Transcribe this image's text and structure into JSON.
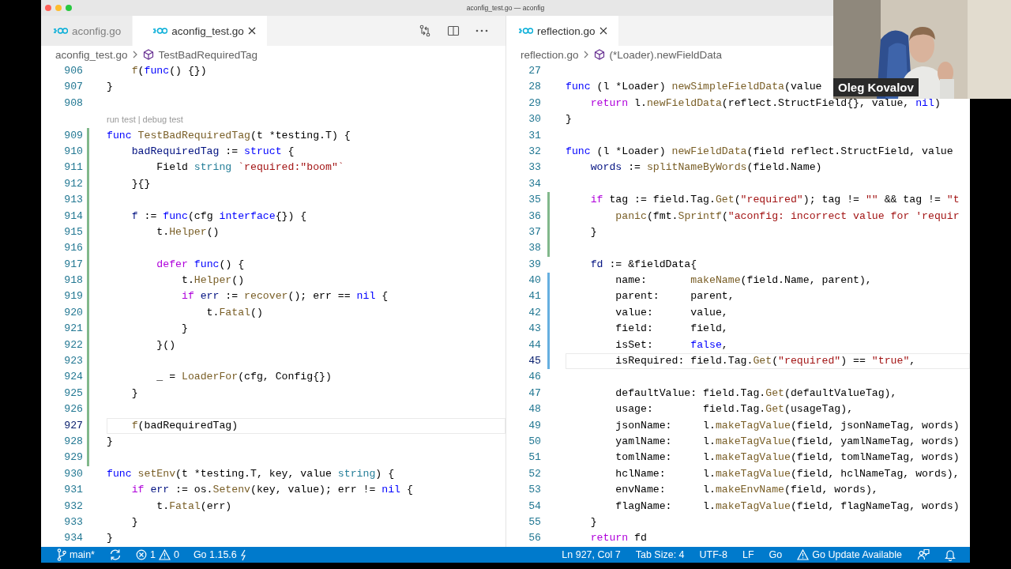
{
  "window": {
    "title": "aconfig_test.go — aconfig"
  },
  "editor_groups": [
    {
      "tabs": [
        {
          "label": "aconfig.go",
          "selected": false
        },
        {
          "label": "aconfig_test.go",
          "selected": true
        }
      ],
      "actions": [
        {
          "kind": "compare"
        },
        {
          "kind": "split"
        },
        {
          "kind": "more"
        }
      ],
      "breadcrumbs": {
        "file": "aconfig_test.go",
        "symbol": "TestBadRequiredTag"
      },
      "lines": [
        {
          "kind": "code",
          "number": "906",
          "current": false,
          "tokens": [
            {
              "kind": "function",
              "text": "    f"
            },
            {
              "kind": "plain",
              "text": "("
            },
            {
              "kind": "keyword",
              "text": "func"
            },
            {
              "kind": "plain",
              "text": "() {})"
            }
          ]
        },
        {
          "kind": "code",
          "number": "907",
          "current": false,
          "tokens": [
            {
              "kind": "plain",
              "text": "}"
            }
          ]
        },
        {
          "kind": "code",
          "number": "908",
          "current": false
        },
        {
          "kind": "codelens",
          "links": [
            "run test",
            "debug test"
          ],
          "separator": "|"
        },
        {
          "kind": "code",
          "number": "909",
          "current": false,
          "color": "#81b88b",
          "tokens": [
            {
              "kind": "keyword",
              "text": "func"
            },
            {
              "kind": "function",
              "text": " TestBadRequiredTag"
            },
            {
              "kind": "plain",
              "text": "(t *testing.T) {"
            }
          ]
        },
        {
          "kind": "code",
          "number": "910",
          "current": false,
          "color": "#81b88b",
          "tokens": [
            {
              "kind": "variable",
              "text": "    badRequiredTag"
            },
            {
              "kind": "plain",
              "text": " := "
            },
            {
              "kind": "keyword",
              "text": "struct"
            },
            {
              "kind": "plain",
              "text": " {"
            }
          ]
        },
        {
          "kind": "code",
          "number": "911",
          "current": false,
          "color": "#81b88b",
          "tokens": [
            {
              "kind": "plain",
              "text": "        Field "
            },
            {
              "kind": "type",
              "text": "string"
            },
            {
              "kind": "string",
              "text": " `required:\"boom\"`"
            }
          ]
        },
        {
          "kind": "code",
          "number": "912",
          "current": false,
          "color": "#81b88b",
          "tokens": [
            {
              "kind": "plain",
              "text": "    }{}"
            }
          ]
        },
        {
          "kind": "code",
          "number": "913",
          "current": false,
          "color": "#81b88b"
        },
        {
          "kind": "code",
          "number": "914",
          "current": false,
          "color": "#81b88b",
          "tokens": [
            {
              "kind": "variable",
              "text": "    f"
            },
            {
              "kind": "plain",
              "text": " := "
            },
            {
              "kind": "keyword",
              "text": "func"
            },
            {
              "kind": "plain",
              "text": "(cfg "
            },
            {
              "kind": "keyword",
              "text": "interface"
            },
            {
              "kind": "plain",
              "text": "{}) {"
            }
          ]
        },
        {
          "kind": "code",
          "number": "915",
          "current": false,
          "color": "#81b88b",
          "tokens": [
            {
              "kind": "plain",
              "text": "        t."
            },
            {
              "kind": "function",
              "text": "Helper"
            },
            {
              "kind": "plain",
              "text": "()"
            }
          ]
        },
        {
          "kind": "code",
          "number": "916",
          "current": false,
          "color": "#81b88b"
        },
        {
          "kind": "code",
          "number": "917",
          "current": false,
          "color": "#81b88b",
          "tokens": [
            {
              "kind": "control",
              "text": "        defer"
            },
            {
              "kind": "keyword",
              "text": " func"
            },
            {
              "kind": "plain",
              "text": "() {"
            }
          ]
        },
        {
          "kind": "code",
          "number": "918",
          "current": false,
          "color": "#81b88b",
          "tokens": [
            {
              "kind": "plain",
              "text": "            t."
            },
            {
              "kind": "function",
              "text": "Helper"
            },
            {
              "kind": "plain",
              "text": "()"
            }
          ]
        },
        {
          "kind": "code",
          "number": "919",
          "current": false,
          "color": "#81b88b",
          "tokens": [
            {
              "kind": "control",
              "text": "            if"
            },
            {
              "kind": "variable",
              "text": " err"
            },
            {
              "kind": "plain",
              "text": " := "
            },
            {
              "kind": "function",
              "text": "recover"
            },
            {
              "kind": "plain",
              "text": "(); err == "
            },
            {
              "kind": "keyword",
              "text": "nil"
            },
            {
              "kind": "plain",
              "text": " {"
            }
          ]
        },
        {
          "kind": "code",
          "number": "920",
          "current": false,
          "color": "#81b88b",
          "tokens": [
            {
              "kind": "plain",
              "text": "                t."
            },
            {
              "kind": "function",
              "text": "Fatal"
            },
            {
              "kind": "plain",
              "text": "()"
            }
          ]
        },
        {
          "kind": "code",
          "number": "921",
          "current": false,
          "color": "#81b88b",
          "tokens": [
            {
              "kind": "plain",
              "text": "            }"
            }
          ]
        },
        {
          "kind": "code",
          "number": "922",
          "current": false,
          "color": "#81b88b",
          "tokens": [
            {
              "kind": "plain",
              "text": "        }()"
            }
          ]
        },
        {
          "kind": "code",
          "number": "923",
          "current": false,
          "color": "#81b88b"
        },
        {
          "kind": "code",
          "number": "924",
          "current": false,
          "color": "#81b88b",
          "tokens": [
            {
              "kind": "plain",
              "text": "        _ = "
            },
            {
              "kind": "function",
              "text": "LoaderFor"
            },
            {
              "kind": "plain",
              "text": "(cfg, Config{})"
            }
          ]
        },
        {
          "kind": "code",
          "number": "925",
          "current": false,
          "color": "#81b88b",
          "tokens": [
            {
              "kind": "plain",
              "text": "    }"
            }
          ]
        },
        {
          "kind": "code",
          "number": "926",
          "current": false,
          "color": "#81b88b"
        },
        {
          "kind": "code",
          "number": "927",
          "current": true,
          "color": "#81b88b",
          "tokens": [
            {
              "kind": "function",
              "text": "    f"
            },
            {
              "kind": "plain",
              "text": "(badRequiredTag)"
            }
          ]
        },
        {
          "kind": "code",
          "number": "928",
          "current": false,
          "color": "#81b88b",
          "tokens": [
            {
              "kind": "plain",
              "text": "}"
            }
          ]
        },
        {
          "kind": "code",
          "number": "929",
          "current": false,
          "color": "#81b88b"
        },
        {
          "kind": "code",
          "number": "930",
          "current": false,
          "tokens": [
            {
              "kind": "keyword",
              "text": "func"
            },
            {
              "kind": "function",
              "text": " setEnv"
            },
            {
              "kind": "plain",
              "text": "(t *testing.T, key, value "
            },
            {
              "kind": "type",
              "text": "string"
            },
            {
              "kind": "plain",
              "text": ") {"
            }
          ]
        },
        {
          "kind": "code",
          "number": "931",
          "current": false,
          "tokens": [
            {
              "kind": "control",
              "text": "    if"
            },
            {
              "kind": "variable",
              "text": " err"
            },
            {
              "kind": "plain",
              "text": " := os."
            },
            {
              "kind": "function",
              "text": "Setenv"
            },
            {
              "kind": "plain",
              "text": "(key, value); err != "
            },
            {
              "kind": "keyword",
              "text": "nil"
            },
            {
              "kind": "plain",
              "text": " {"
            }
          ]
        },
        {
          "kind": "code",
          "number": "932",
          "current": false,
          "tokens": [
            {
              "kind": "plain",
              "text": "        t."
            },
            {
              "kind": "function",
              "text": "Fatal"
            },
            {
              "kind": "plain",
              "text": "(err)"
            }
          ]
        },
        {
          "kind": "code",
          "number": "933",
          "current": false,
          "tokens": [
            {
              "kind": "plain",
              "text": "    }"
            }
          ]
        },
        {
          "kind": "code",
          "number": "934",
          "current": false,
          "tokens": [
            {
              "kind": "plain",
              "text": "}"
            }
          ]
        }
      ]
    },
    {
      "tabs": [
        {
          "label": "reflection.go",
          "selected": true
        }
      ],
      "breadcrumbs": {
        "file": "reflection.go",
        "symbol": "(*Loader).newFieldData"
      },
      "lines": [
        {
          "kind": "code",
          "number": "27",
          "current": false
        },
        {
          "kind": "code",
          "number": "28",
          "current": false,
          "tokens": [
            {
              "kind": "keyword",
              "text": "func"
            },
            {
              "kind": "plain",
              "text": " (l *Loader) "
            },
            {
              "kind": "function",
              "text": "newSimpleFieldData"
            },
            {
              "kind": "plain",
              "text": "(value"
            }
          ]
        },
        {
          "kind": "code",
          "number": "29",
          "current": false,
          "tokens": [
            {
              "kind": "control",
              "text": "    return"
            },
            {
              "kind": "plain",
              "text": " l."
            },
            {
              "kind": "function",
              "text": "newFieldData"
            },
            {
              "kind": "plain",
              "text": "(reflect.StructField{}, value, "
            },
            {
              "kind": "keyword",
              "text": "nil"
            },
            {
              "kind": "plain",
              "text": ")"
            }
          ]
        },
        {
          "kind": "code",
          "number": "30",
          "current": false,
          "tokens": [
            {
              "kind": "plain",
              "text": "}"
            }
          ]
        },
        {
          "kind": "code",
          "number": "31",
          "current": false
        },
        {
          "kind": "code",
          "number": "32",
          "current": false,
          "tokens": [
            {
              "kind": "keyword",
              "text": "func"
            },
            {
              "kind": "plain",
              "text": " (l *Loader) "
            },
            {
              "kind": "function",
              "text": "newFieldData"
            },
            {
              "kind": "plain",
              "text": "(field reflect.StructField, value"
            }
          ]
        },
        {
          "kind": "code",
          "number": "33",
          "current": false,
          "tokens": [
            {
              "kind": "variable",
              "text": "    words"
            },
            {
              "kind": "plain",
              "text": " := "
            },
            {
              "kind": "function",
              "text": "splitNameByWords"
            },
            {
              "kind": "plain",
              "text": "(field.Name)"
            }
          ]
        },
        {
          "kind": "code",
          "number": "34",
          "current": false
        },
        {
          "kind": "code",
          "number": "35",
          "current": false,
          "color": "#81b88b",
          "tokens": [
            {
              "kind": "control",
              "text": "    if"
            },
            {
              "kind": "plain",
              "text": " tag := field.Tag."
            },
            {
              "kind": "function",
              "text": "Get"
            },
            {
              "kind": "plain",
              "text": "("
            },
            {
              "kind": "string",
              "text": "\"required\""
            },
            {
              "kind": "plain",
              "text": "); tag != "
            },
            {
              "kind": "string",
              "text": "\"\""
            },
            {
              "kind": "plain",
              "text": " && tag != "
            },
            {
              "kind": "string",
              "text": "\"t"
            }
          ]
        },
        {
          "kind": "code",
          "number": "36",
          "current": false,
          "color": "#81b88b",
          "tokens": [
            {
              "kind": "function",
              "text": "        panic"
            },
            {
              "kind": "plain",
              "text": "(fmt."
            },
            {
              "kind": "function",
              "text": "Sprintf"
            },
            {
              "kind": "plain",
              "text": "("
            },
            {
              "kind": "string",
              "text": "\"aconfig: incorrect value for 'requir"
            }
          ]
        },
        {
          "kind": "code",
          "number": "37",
          "current": false,
          "color": "#81b88b",
          "tokens": [
            {
              "kind": "plain",
              "text": "    }"
            }
          ]
        },
        {
          "kind": "code",
          "number": "38",
          "current": false,
          "color": "#81b88b"
        },
        {
          "kind": "code",
          "number": "39",
          "current": false,
          "tokens": [
            {
              "kind": "variable",
              "text": "    fd"
            },
            {
              "kind": "plain",
              "text": " := &fieldData{"
            }
          ]
        },
        {
          "kind": "code",
          "number": "40",
          "current": false,
          "color": "#66afe0",
          "tokens": [
            {
              "kind": "plain",
              "text": "        name:       "
            },
            {
              "kind": "function",
              "text": "makeName"
            },
            {
              "kind": "plain",
              "text": "(field.Name, parent),"
            }
          ]
        },
        {
          "kind": "code",
          "number": "41",
          "current": false,
          "color": "#66afe0",
          "tokens": [
            {
              "kind": "plain",
              "text": "        parent:     parent,"
            }
          ]
        },
        {
          "kind": "code",
          "number": "42",
          "current": false,
          "color": "#66afe0",
          "tokens": [
            {
              "kind": "plain",
              "text": "        value:      value,"
            }
          ]
        },
        {
          "kind": "code",
          "number": "43",
          "current": false,
          "color": "#66afe0",
          "tokens": [
            {
              "kind": "plain",
              "text": "        field:      field,"
            }
          ]
        },
        {
          "kind": "code",
          "number": "44",
          "current": false,
          "color": "#66afe0",
          "tokens": [
            {
              "kind": "plain",
              "text": "        isSet:      "
            },
            {
              "kind": "keyword",
              "text": "false"
            },
            {
              "kind": "plain",
              "text": ","
            }
          ]
        },
        {
          "kind": "code",
          "number": "45",
          "current": true,
          "color": "#66afe0",
          "tokens": [
            {
              "kind": "plain",
              "text": "        isRequired: field.Tag."
            },
            {
              "kind": "function",
              "text": "Get"
            },
            {
              "kind": "plain",
              "text": "("
            },
            {
              "kind": "string",
              "text": "\"required\""
            },
            {
              "kind": "plain",
              "text": ") == "
            },
            {
              "kind": "string",
              "text": "\"true\""
            },
            {
              "kind": "plain",
              "text": ","
            }
          ]
        },
        {
          "kind": "code",
          "number": "46",
          "current": false
        },
        {
          "kind": "code",
          "number": "47",
          "current": false,
          "tokens": [
            {
              "kind": "plain",
              "text": "        defaultValue: field.Tag."
            },
            {
              "kind": "function",
              "text": "Get"
            },
            {
              "kind": "plain",
              "text": "(defaultValueTag),"
            }
          ]
        },
        {
          "kind": "code",
          "number": "48",
          "current": false,
          "tokens": [
            {
              "kind": "plain",
              "text": "        usage:        field.Tag."
            },
            {
              "kind": "function",
              "text": "Get"
            },
            {
              "kind": "plain",
              "text": "(usageTag),"
            }
          ]
        },
        {
          "kind": "code",
          "number": "49",
          "current": false,
          "tokens": [
            {
              "kind": "plain",
              "text": "        jsonName:     l."
            },
            {
              "kind": "function",
              "text": "makeTagValue"
            },
            {
              "kind": "plain",
              "text": "(field, jsonNameTag, words)"
            }
          ]
        },
        {
          "kind": "code",
          "number": "50",
          "current": false,
          "tokens": [
            {
              "kind": "plain",
              "text": "        yamlName:     l."
            },
            {
              "kind": "function",
              "text": "makeTagValue"
            },
            {
              "kind": "plain",
              "text": "(field, yamlNameTag, words)"
            }
          ]
        },
        {
          "kind": "code",
          "number": "51",
          "current": false,
          "tokens": [
            {
              "kind": "plain",
              "text": "        tomlName:     l."
            },
            {
              "kind": "function",
              "text": "makeTagValue"
            },
            {
              "kind": "plain",
              "text": "(field, tomlNameTag, words)"
            }
          ]
        },
        {
          "kind": "code",
          "number": "52",
          "current": false,
          "tokens": [
            {
              "kind": "plain",
              "text": "        hclName:      l."
            },
            {
              "kind": "function",
              "text": "makeTagValue"
            },
            {
              "kind": "plain",
              "text": "(field, hclNameTag, words),"
            }
          ]
        },
        {
          "kind": "code",
          "number": "53",
          "current": false,
          "tokens": [
            {
              "kind": "plain",
              "text": "        envName:      l."
            },
            {
              "kind": "function",
              "text": "makeEnvName"
            },
            {
              "kind": "plain",
              "text": "(field, words),"
            }
          ]
        },
        {
          "kind": "code",
          "number": "54",
          "current": false,
          "tokens": [
            {
              "kind": "plain",
              "text": "        flagName:     l."
            },
            {
              "kind": "function",
              "text": "makeTagValue"
            },
            {
              "kind": "plain",
              "text": "(field, flagNameTag, words)"
            }
          ]
        },
        {
          "kind": "code",
          "number": "55",
          "current": false,
          "tokens": [
            {
              "kind": "plain",
              "text": "    }"
            }
          ]
        },
        {
          "kind": "code",
          "number": "56",
          "current": false,
          "tokens": [
            {
              "kind": "control",
              "text": "    return"
            },
            {
              "kind": "plain",
              "text": " fd"
            }
          ]
        }
      ]
    }
  ],
  "status_bar": {
    "left": [
      {
        "kind": "branch",
        "text": "main*"
      },
      {
        "kind": "sync"
      },
      {
        "kind": "problems",
        "errors": "1",
        "warnings": "0"
      },
      {
        "kind": "version",
        "text": "Go 1.15.6"
      }
    ],
    "right": [
      {
        "kind": "text",
        "text": "Ln 927, Col 7"
      },
      {
        "kind": "text",
        "text": "Tab Size: 4"
      },
      {
        "kind": "text",
        "text": "UTF-8"
      },
      {
        "kind": "text",
        "text": "LF"
      },
      {
        "kind": "text",
        "text": "Go"
      },
      {
        "kind": "warning",
        "text": "Go Update Available"
      },
      {
        "kind": "feedback"
      },
      {
        "kind": "bell"
      }
    ]
  },
  "video": {
    "kind": "picture",
    "participant": "Oleg Kovalov"
  }
}
